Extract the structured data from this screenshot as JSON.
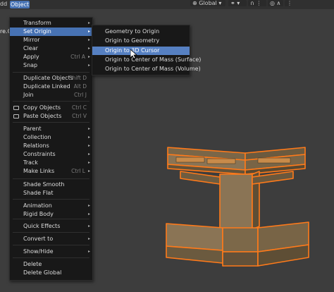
{
  "header": {
    "add_label": "dd",
    "object_label": "Object",
    "transform_orientation": "Global",
    "clipped_label": "re.C"
  },
  "object_menu": {
    "items": [
      {
        "label": "Transform",
        "arrow": "▸"
      },
      {
        "label": "Set Origin",
        "arrow": "▸"
      },
      {
        "label": "Mirror",
        "arrow": "▸"
      },
      {
        "label": "Clear",
        "arrow": "▸"
      },
      {
        "label": "Apply",
        "shortcut": "Ctrl A",
        "arrow": "▸"
      },
      {
        "label": "Snap",
        "arrow": "▸"
      },
      {
        "label": "Duplicate Objects",
        "shortcut": "Shift D"
      },
      {
        "label": "Duplicate Linked",
        "shortcut": "Alt D"
      },
      {
        "label": "Join",
        "shortcut": "Ctrl J"
      },
      {
        "label": "Copy Objects",
        "shortcut": "Ctrl C"
      },
      {
        "label": "Paste Objects",
        "shortcut": "Ctrl V"
      },
      {
        "label": "Parent",
        "arrow": "▸"
      },
      {
        "label": "Collection",
        "arrow": "▸"
      },
      {
        "label": "Relations",
        "arrow": "▸"
      },
      {
        "label": "Constraints",
        "arrow": "▸"
      },
      {
        "label": "Track",
        "arrow": "▸"
      },
      {
        "label": "Make Links",
        "shortcut": "Ctrl L",
        "arrow": "▸"
      },
      {
        "label": "Shade Smooth"
      },
      {
        "label": "Shade Flat"
      },
      {
        "label": "Animation",
        "arrow": "▸"
      },
      {
        "label": "Rigid Body",
        "arrow": "▸"
      },
      {
        "label": "Quick Effects",
        "arrow": "▸"
      },
      {
        "label": "Convert to",
        "arrow": "▸"
      },
      {
        "label": "Show/Hide",
        "arrow": "▸"
      },
      {
        "label": "Delete"
      },
      {
        "label": "Delete Global"
      }
    ]
  },
  "set_origin_submenu": {
    "items": [
      {
        "label": "Geometry to Origin"
      },
      {
        "label": "Origin to Geometry"
      },
      {
        "label": "Origin to 3D Cursor"
      },
      {
        "label": "Origin to Center of Mass (Surface)"
      },
      {
        "label": "Origin to Center of Mass (Volume)"
      }
    ]
  },
  "colors": {
    "accent": "#4772b3",
    "selection_outline": "#ff7a1a",
    "menu_bg": "#181818",
    "viewport_bg": "#3d3d3d"
  }
}
